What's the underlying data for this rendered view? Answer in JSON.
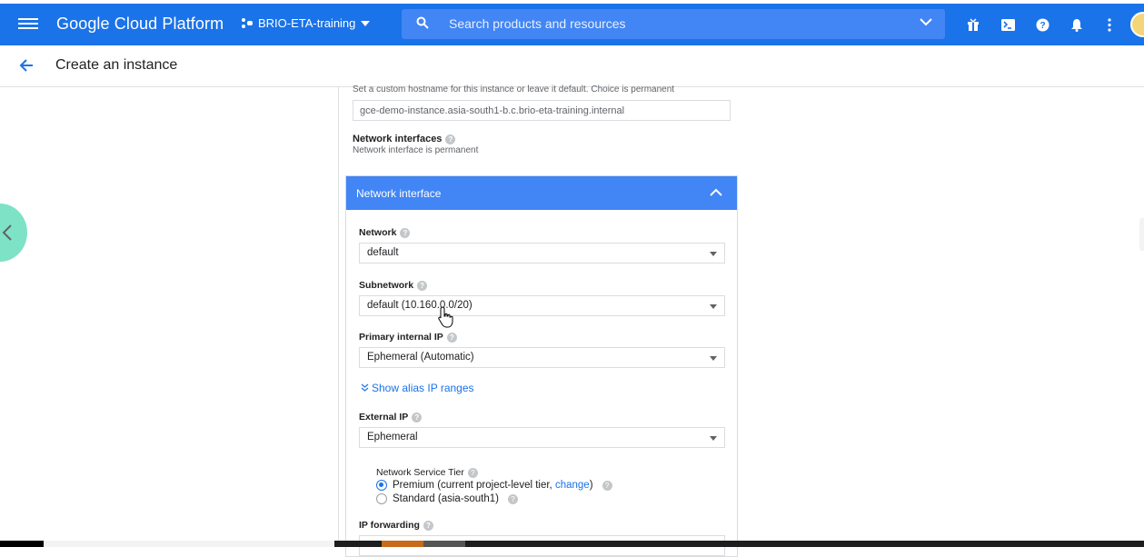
{
  "header": {
    "brand": "Google Cloud Platform",
    "project": "BRIO-ETA-training",
    "search_placeholder": "Search products and resources",
    "accent": "#1a73e8"
  },
  "subheader": {
    "title": "Create an instance"
  },
  "hostname": {
    "hint": "Set a custom hostname for this instance or leave it default. Choice is permanent",
    "value": "gce-demo-instance.asia-south1-b.c.brio-eta-training.internal"
  },
  "network_interfaces": {
    "label": "Network interfaces",
    "sub": "Network interface is permanent"
  },
  "panel": {
    "title": "Network interface",
    "network": {
      "label": "Network",
      "value": "default"
    },
    "subnetwork": {
      "label": "Subnetwork",
      "value": "default (10.160.0.0/20)"
    },
    "primary_ip": {
      "label": "Primary internal IP",
      "value": "Ephemeral (Automatic)"
    },
    "alias_link": "Show alias IP ranges",
    "external_ip": {
      "label": "External IP",
      "value": "Ephemeral"
    },
    "tier": {
      "label": "Network Service Tier",
      "premium_prefix": "Premium (current project-level tier, ",
      "premium_link": "change",
      "premium_suffix": ")",
      "standard": "Standard (asia-south1)"
    },
    "ip_forwarding": {
      "label": "IP forwarding"
    }
  },
  "icons": [
    "menu-icon",
    "project-icon",
    "search-icon",
    "chevron-down-icon",
    "gift-icon",
    "terminal-icon",
    "help-icon",
    "bell-icon",
    "more-vert-icon",
    "back-arrow-icon",
    "chevron-up-icon",
    "chevron-left-icon",
    "hand-cursor-icon"
  ]
}
